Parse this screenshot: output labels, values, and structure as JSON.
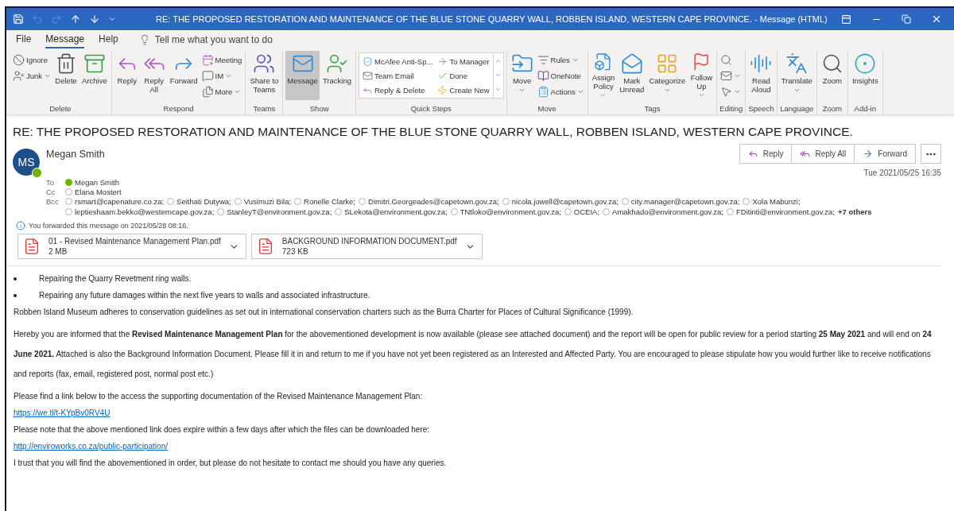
{
  "window": {
    "title": "RE: THE PROPOSED RESTORATION AND MAINTENANCE OF THE BLUE STONE QUARRY WALL, ROBBEN ISLAND, WESTERN CAPE PROVINCE.  -  Message (HTML)",
    "quick_access": [
      {
        "disabled": false
      },
      {
        "disabled": true
      },
      {
        "disabled": true
      },
      {
        "disabled": false
      },
      {
        "disabled": false
      },
      {
        "disabled": false
      }
    ]
  },
  "menu": {
    "tabs": [
      {
        "label": "File",
        "selected": false
      },
      {
        "label": "Message",
        "selected": true
      },
      {
        "label": "Help",
        "selected": false
      }
    ],
    "tell_me": "Tell me what you want to do"
  },
  "ribbon": {
    "groups": [
      {
        "label": "Delete",
        "items": [
          {
            "kind": "stack",
            "items": [
              {
                "label": "Ignore",
                "dropdown": false
              },
              {
                "label": "Junk",
                "dropdown": true
              }
            ]
          },
          {
            "kind": "large",
            "lines": [
              "Delete"
            ],
            "dropdown": false,
            "selected": false
          },
          {
            "kind": "large",
            "lines": [
              "Archive"
            ],
            "dropdown": false,
            "selected": false
          }
        ]
      },
      {
        "label": "Respond",
        "items": [
          {
            "kind": "large",
            "lines": [
              "Reply"
            ],
            "dropdown": false,
            "selected": false
          },
          {
            "kind": "large",
            "lines": [
              "Reply",
              "All"
            ],
            "dropdown": false,
            "selected": false
          },
          {
            "kind": "large",
            "lines": [
              "Forward"
            ],
            "dropdown": false,
            "selected": false
          },
          {
            "kind": "stack",
            "items": [
              {
                "label": "Meeting",
                "dropdown": false
              },
              {
                "label": "IM",
                "dropdown": true
              },
              {
                "label": "More",
                "dropdown": true
              }
            ]
          }
        ]
      },
      {
        "label": "Teams",
        "items": [
          {
            "kind": "large",
            "lines": [
              "Share to",
              "Teams"
            ],
            "dropdown": false,
            "selected": false
          }
        ]
      },
      {
        "label": "Show",
        "items": [
          {
            "kind": "large",
            "lines": [
              "Message"
            ],
            "dropdown": false,
            "selected": true
          },
          {
            "kind": "large",
            "lines": [
              "Tracking"
            ],
            "dropdown": false,
            "selected": false
          }
        ]
      },
      {
        "label": "Quick Steps",
        "items": [
          {
            "kind": "gallery",
            "items": [
              "McAfee Anti-Sp...",
              "Team Email",
              "Reply & Delete",
              "To Manager",
              "Done",
              "Create New"
            ]
          }
        ]
      },
      {
        "label": "Move",
        "items": [
          {
            "kind": "large",
            "lines": [
              "Move"
            ],
            "dropdown": true,
            "selected": false
          },
          {
            "kind": "stack",
            "items": [
              {
                "label": "Rules",
                "dropdown": true
              },
              {
                "label": "OneNote",
                "dropdown": false
              },
              {
                "label": "Actions",
                "dropdown": true
              }
            ]
          }
        ]
      },
      {
        "label": "Tags",
        "items": [
          {
            "kind": "large",
            "lines": [
              "Assign",
              "Policy"
            ],
            "dropdown": true,
            "selected": false
          },
          {
            "kind": "large",
            "lines": [
              "Mark",
              "Unread"
            ],
            "dropdown": false,
            "selected": false
          },
          {
            "kind": "large",
            "lines": [
              "Categorize"
            ],
            "dropdown": true,
            "selected": false
          },
          {
            "kind": "large",
            "lines": [
              "Follow",
              "Up"
            ],
            "dropdown": true,
            "selected": false
          }
        ]
      },
      {
        "label": "Editing",
        "items": [
          {
            "kind": "stack",
            "items": [
              {
                "dropdown": false
              },
              {
                "dropdown": true
              },
              {
                "dropdown": true
              }
            ]
          }
        ]
      },
      {
        "label": "Speech",
        "items": [
          {
            "kind": "large",
            "lines": [
              "Read",
              "Aloud"
            ],
            "dropdown": false,
            "selected": false
          }
        ]
      },
      {
        "label": "Language",
        "items": [
          {
            "kind": "large",
            "lines": [
              "Translate"
            ],
            "dropdown": true,
            "selected": false
          }
        ]
      },
      {
        "label": "Zoom",
        "items": [
          {
            "kind": "large",
            "lines": [
              "Zoom"
            ],
            "dropdown": false,
            "selected": false
          }
        ]
      },
      {
        "label": "Add-in",
        "items": [
          {
            "kind": "large",
            "lines": [
              "Insights"
            ],
            "dropdown": false,
            "selected": false
          }
        ]
      }
    ]
  },
  "message": {
    "subject": "RE: THE PROPOSED RESTORATION AND MAINTENANCE OF THE BLUE STONE QUARRY WALL, ROBBEN ISLAND, WESTERN CAPE PROVINCE.",
    "sender": {
      "initials": "MS",
      "name": "Megan Smith",
      "online": true
    },
    "actions": [
      "Reply",
      "Reply All",
      "Forward"
    ],
    "date": "Tue 2021/05/25 16:35",
    "to_label": "To",
    "to": [
      {
        "name": "Megan Smith",
        "online": true
      }
    ],
    "cc_label": "Cc",
    "cc": [
      {
        "name": "Elana Mostert",
        "online": false
      }
    ],
    "bcc_label": "Bcc",
    "bcc": [
      {
        "name": "rsmart@capenature.co.za;",
        "online": false
      },
      {
        "name": "Seithati Dutywa;",
        "online": false
      },
      {
        "name": "Vusimuzi Bila;",
        "online": false
      },
      {
        "name": "Ronelle Clarke;",
        "online": false
      },
      {
        "name": "Dimitri.Georgeades@capetown.gov.za;",
        "online": false
      },
      {
        "name": "nicola.jowell@capetown.gov.za;",
        "online": false
      },
      {
        "name": "city.manager@capetown.gov.za;",
        "online": false
      },
      {
        "name": "Xola Mabunzi;",
        "online": false
      },
      {
        "name": "leptieshaam.bekko@westerncape.gov.za;",
        "online": false
      },
      {
        "name": "StanleyT@environment.gov.za;",
        "online": false
      },
      {
        "name": "SLekota@environment.gov.za;",
        "online": false
      },
      {
        "name": "TNtloko@environment.gov.za;",
        "online": false
      },
      {
        "name": "OCEIA;",
        "online": false
      },
      {
        "name": "Amakhado@environment.gov.za;",
        "online": false
      },
      {
        "name": "FDitinti@environment.gov.za;",
        "online": false
      }
    ],
    "bcc_more": "+7 others",
    "info": "You forwarded this message on 2021/05/28 08:16.",
    "attachments": [
      {
        "name": "01 - Revised Maintenance Management Plan.pdf",
        "size": "2 MB"
      },
      {
        "name": "BACKGROUND INFORMATION DOCUMENT.pdf",
        "size": "723 KB"
      }
    ],
    "body": [
      {
        "kind": "bullet",
        "text": "Repairing the Quarry Revetment ring walls."
      },
      {
        "kind": "bullet",
        "text": "Repairing any future damages within the next five years to walls and associated infrastructure."
      },
      {
        "kind": "paragraph",
        "text": "Robben Island Museum adheres to conservation guidelines as set out in international conservation charters such as the Burra Charter for Places of Cultural Significance (1999)."
      },
      {
        "kind": "paragraph",
        "text": "Hereby you are informed that the **Revised Maintenance Management Plan** for the abovementioned development is now available (please see attached document) and the report will be open for public review for a period starting **25 May 2021** and will end on **24 June 2021.**  Attached is also the Background Information Document. Please fill it in and return to me if you have not yet been registered as an Interested and Affected Party. You are encouraged to please stipulate how you would further like to receive notifications and reports (fax, email, registered post, normal post etc.)"
      },
      {
        "kind": "paragraph",
        "text": "Please find a link below to the access the supporting documentation of the Revised Maintenance Management Plan:"
      },
      {
        "kind": "link",
        "text": "https://we.tl/t-KYpBv0RV4U"
      },
      {
        "kind": "paragraph",
        "text": "Please note that the above mentioned link does expire within a few days after which the files can be downloaded here:"
      },
      {
        "kind": "link",
        "text": "http://enviroworks.co.za/public-participation/"
      },
      {
        "kind": "paragraph",
        "text": "I trust that you will find the abovementioned in order, but please do not hesitate to contact me should you have any queries."
      }
    ]
  }
}
